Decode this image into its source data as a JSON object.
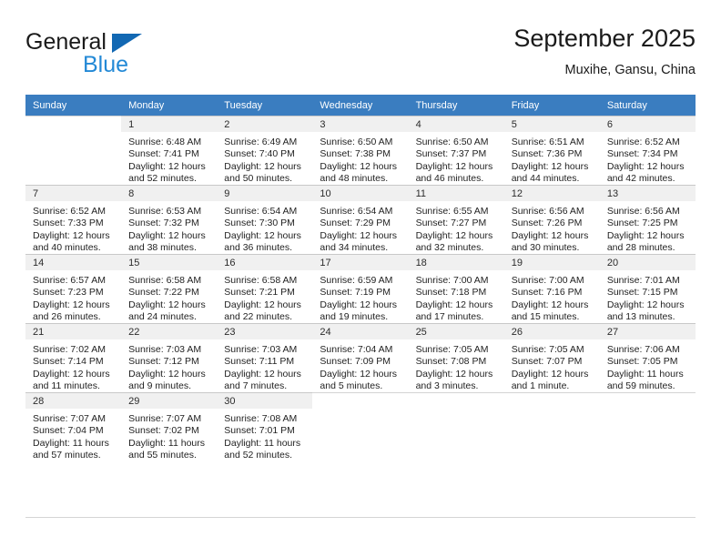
{
  "brand": {
    "name_top": "General",
    "name_bottom": "Blue",
    "triangle_color": "#1268b3",
    "blue_color": "#2389d6"
  },
  "header": {
    "title": "September 2025",
    "subtitle": "Muxihe, Gansu, China"
  },
  "theme": {
    "header_row_bg": "#3a7dc0",
    "header_row_text": "#ffffff",
    "daynum_bg": "#f0f0f0",
    "grid_line": "#d4d4d4"
  },
  "weekdays": [
    "Sunday",
    "Monday",
    "Tuesday",
    "Wednesday",
    "Thursday",
    "Friday",
    "Saturday"
  ],
  "weeks": [
    [
      {
        "day": "",
        "sunrise": "",
        "sunset": "",
        "daylight1": "",
        "daylight2": ""
      },
      {
        "day": "1",
        "sunrise": "Sunrise: 6:48 AM",
        "sunset": "Sunset: 7:41 PM",
        "daylight1": "Daylight: 12 hours",
        "daylight2": "and 52 minutes."
      },
      {
        "day": "2",
        "sunrise": "Sunrise: 6:49 AM",
        "sunset": "Sunset: 7:40 PM",
        "daylight1": "Daylight: 12 hours",
        "daylight2": "and 50 minutes."
      },
      {
        "day": "3",
        "sunrise": "Sunrise: 6:50 AM",
        "sunset": "Sunset: 7:38 PM",
        "daylight1": "Daylight: 12 hours",
        "daylight2": "and 48 minutes."
      },
      {
        "day": "4",
        "sunrise": "Sunrise: 6:50 AM",
        "sunset": "Sunset: 7:37 PM",
        "daylight1": "Daylight: 12 hours",
        "daylight2": "and 46 minutes."
      },
      {
        "day": "5",
        "sunrise": "Sunrise: 6:51 AM",
        "sunset": "Sunset: 7:36 PM",
        "daylight1": "Daylight: 12 hours",
        "daylight2": "and 44 minutes."
      },
      {
        "day": "6",
        "sunrise": "Sunrise: 6:52 AM",
        "sunset": "Sunset: 7:34 PM",
        "daylight1": "Daylight: 12 hours",
        "daylight2": "and 42 minutes."
      }
    ],
    [
      {
        "day": "7",
        "sunrise": "Sunrise: 6:52 AM",
        "sunset": "Sunset: 7:33 PM",
        "daylight1": "Daylight: 12 hours",
        "daylight2": "and 40 minutes."
      },
      {
        "day": "8",
        "sunrise": "Sunrise: 6:53 AM",
        "sunset": "Sunset: 7:32 PM",
        "daylight1": "Daylight: 12 hours",
        "daylight2": "and 38 minutes."
      },
      {
        "day": "9",
        "sunrise": "Sunrise: 6:54 AM",
        "sunset": "Sunset: 7:30 PM",
        "daylight1": "Daylight: 12 hours",
        "daylight2": "and 36 minutes."
      },
      {
        "day": "10",
        "sunrise": "Sunrise: 6:54 AM",
        "sunset": "Sunset: 7:29 PM",
        "daylight1": "Daylight: 12 hours",
        "daylight2": "and 34 minutes."
      },
      {
        "day": "11",
        "sunrise": "Sunrise: 6:55 AM",
        "sunset": "Sunset: 7:27 PM",
        "daylight1": "Daylight: 12 hours",
        "daylight2": "and 32 minutes."
      },
      {
        "day": "12",
        "sunrise": "Sunrise: 6:56 AM",
        "sunset": "Sunset: 7:26 PM",
        "daylight1": "Daylight: 12 hours",
        "daylight2": "and 30 minutes."
      },
      {
        "day": "13",
        "sunrise": "Sunrise: 6:56 AM",
        "sunset": "Sunset: 7:25 PM",
        "daylight1": "Daylight: 12 hours",
        "daylight2": "and 28 minutes."
      }
    ],
    [
      {
        "day": "14",
        "sunrise": "Sunrise: 6:57 AM",
        "sunset": "Sunset: 7:23 PM",
        "daylight1": "Daylight: 12 hours",
        "daylight2": "and 26 minutes."
      },
      {
        "day": "15",
        "sunrise": "Sunrise: 6:58 AM",
        "sunset": "Sunset: 7:22 PM",
        "daylight1": "Daylight: 12 hours",
        "daylight2": "and 24 minutes."
      },
      {
        "day": "16",
        "sunrise": "Sunrise: 6:58 AM",
        "sunset": "Sunset: 7:21 PM",
        "daylight1": "Daylight: 12 hours",
        "daylight2": "and 22 minutes."
      },
      {
        "day": "17",
        "sunrise": "Sunrise: 6:59 AM",
        "sunset": "Sunset: 7:19 PM",
        "daylight1": "Daylight: 12 hours",
        "daylight2": "and 19 minutes."
      },
      {
        "day": "18",
        "sunrise": "Sunrise: 7:00 AM",
        "sunset": "Sunset: 7:18 PM",
        "daylight1": "Daylight: 12 hours",
        "daylight2": "and 17 minutes."
      },
      {
        "day": "19",
        "sunrise": "Sunrise: 7:00 AM",
        "sunset": "Sunset: 7:16 PM",
        "daylight1": "Daylight: 12 hours",
        "daylight2": "and 15 minutes."
      },
      {
        "day": "20",
        "sunrise": "Sunrise: 7:01 AM",
        "sunset": "Sunset: 7:15 PM",
        "daylight1": "Daylight: 12 hours",
        "daylight2": "and 13 minutes."
      }
    ],
    [
      {
        "day": "21",
        "sunrise": "Sunrise: 7:02 AM",
        "sunset": "Sunset: 7:14 PM",
        "daylight1": "Daylight: 12 hours",
        "daylight2": "and 11 minutes."
      },
      {
        "day": "22",
        "sunrise": "Sunrise: 7:03 AM",
        "sunset": "Sunset: 7:12 PM",
        "daylight1": "Daylight: 12 hours",
        "daylight2": "and 9 minutes."
      },
      {
        "day": "23",
        "sunrise": "Sunrise: 7:03 AM",
        "sunset": "Sunset: 7:11 PM",
        "daylight1": "Daylight: 12 hours",
        "daylight2": "and 7 minutes."
      },
      {
        "day": "24",
        "sunrise": "Sunrise: 7:04 AM",
        "sunset": "Sunset: 7:09 PM",
        "daylight1": "Daylight: 12 hours",
        "daylight2": "and 5 minutes."
      },
      {
        "day": "25",
        "sunrise": "Sunrise: 7:05 AM",
        "sunset": "Sunset: 7:08 PM",
        "daylight1": "Daylight: 12 hours",
        "daylight2": "and 3 minutes."
      },
      {
        "day": "26",
        "sunrise": "Sunrise: 7:05 AM",
        "sunset": "Sunset: 7:07 PM",
        "daylight1": "Daylight: 12 hours",
        "daylight2": "and 1 minute."
      },
      {
        "day": "27",
        "sunrise": "Sunrise: 7:06 AM",
        "sunset": "Sunset: 7:05 PM",
        "daylight1": "Daylight: 11 hours",
        "daylight2": "and 59 minutes."
      }
    ],
    [
      {
        "day": "28",
        "sunrise": "Sunrise: 7:07 AM",
        "sunset": "Sunset: 7:04 PM",
        "daylight1": "Daylight: 11 hours",
        "daylight2": "and 57 minutes."
      },
      {
        "day": "29",
        "sunrise": "Sunrise: 7:07 AM",
        "sunset": "Sunset: 7:02 PM",
        "daylight1": "Daylight: 11 hours",
        "daylight2": "and 55 minutes."
      },
      {
        "day": "30",
        "sunrise": "Sunrise: 7:08 AM",
        "sunset": "Sunset: 7:01 PM",
        "daylight1": "Daylight: 11 hours",
        "daylight2": "and 52 minutes."
      },
      {
        "day": "",
        "sunrise": "",
        "sunset": "",
        "daylight1": "",
        "daylight2": ""
      },
      {
        "day": "",
        "sunrise": "",
        "sunset": "",
        "daylight1": "",
        "daylight2": ""
      },
      {
        "day": "",
        "sunrise": "",
        "sunset": "",
        "daylight1": "",
        "daylight2": ""
      },
      {
        "day": "",
        "sunrise": "",
        "sunset": "",
        "daylight1": "",
        "daylight2": ""
      }
    ]
  ]
}
